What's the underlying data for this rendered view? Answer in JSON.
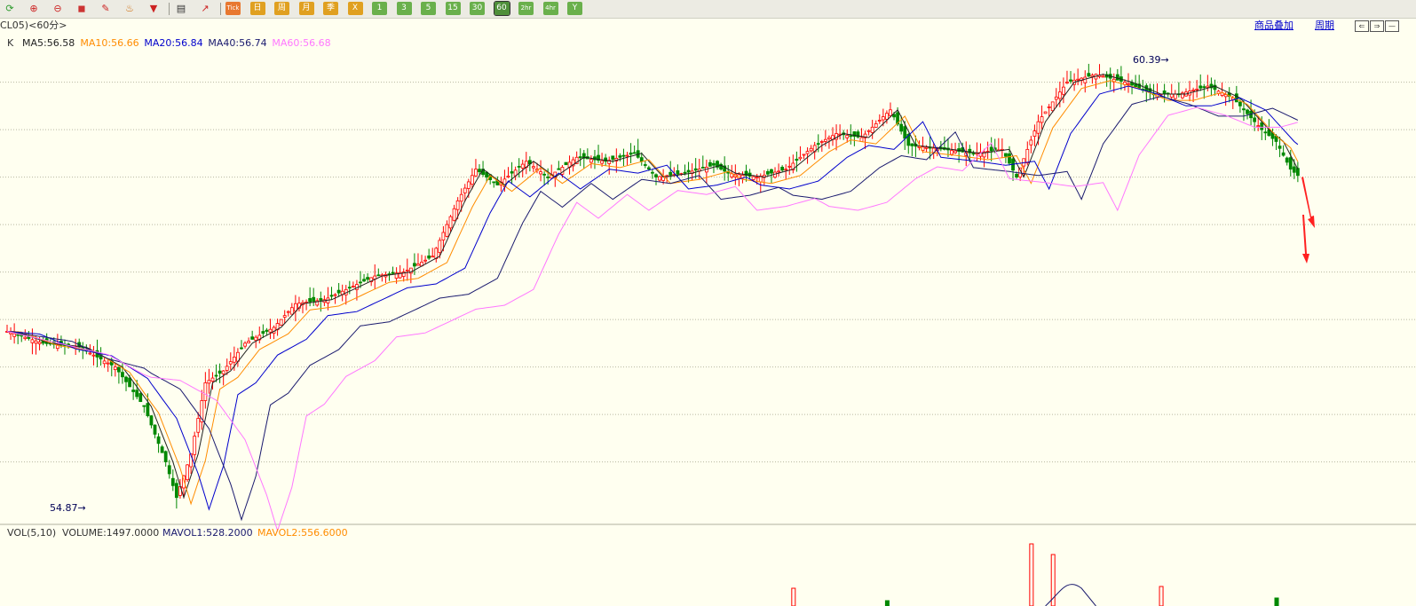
{
  "toolbar": {
    "buttons": [
      {
        "name": "refresh-icon",
        "label": "⟳",
        "kind": "ico",
        "color": "#2e9a2e"
      },
      {
        "name": "zoom-in-icon",
        "label": "⊕",
        "kind": "ico",
        "color": "#cc2222"
      },
      {
        "name": "zoom-out-icon",
        "label": "⊖",
        "kind": "ico",
        "color": "#cc2222"
      },
      {
        "name": "window-icon",
        "label": "◼",
        "kind": "ico",
        "color": "#cc3333"
      },
      {
        "name": "pencil-icon",
        "label": "✎",
        "kind": "ico",
        "color": "#cc2222"
      },
      {
        "name": "paint-icon",
        "label": "♨",
        "kind": "ico",
        "color": "#cc6600"
      },
      {
        "name": "filter-icon",
        "label": "▼",
        "kind": "ico",
        "color": "#cc2222"
      },
      {
        "name": "table-icon",
        "label": "▤",
        "kind": "ico",
        "color": "#333333"
      },
      {
        "name": "trend-icon",
        "label": "↗",
        "kind": "ico",
        "color": "#cc2222"
      },
      {
        "name": "tick-button",
        "label": "Tick",
        "kind": "sq",
        "color": "#e87830"
      },
      {
        "name": "day-button",
        "label": "日",
        "kind": "sq",
        "color": "#e0a020"
      },
      {
        "name": "week-button",
        "label": "周",
        "kind": "sq",
        "color": "#e0a020"
      },
      {
        "name": "month-button",
        "label": "月",
        "kind": "sq",
        "color": "#e0a020"
      },
      {
        "name": "season-button",
        "label": "季",
        "kind": "sq",
        "color": "#e0a020"
      },
      {
        "name": "x-button",
        "label": "X",
        "kind": "sq",
        "color": "#e0a020"
      },
      {
        "name": "1-button",
        "label": "1",
        "kind": "sq",
        "color": "#6ab04c"
      },
      {
        "name": "3-button",
        "label": "3",
        "kind": "sq",
        "color": "#6ab04c"
      },
      {
        "name": "5-button",
        "label": "5",
        "kind": "sq",
        "color": "#6ab04c"
      },
      {
        "name": "15-button",
        "label": "15",
        "kind": "sq",
        "color": "#6ab04c"
      },
      {
        "name": "30-button",
        "label": "30",
        "kind": "sq",
        "color": "#6ab04c"
      },
      {
        "name": "60-button",
        "label": "60",
        "kind": "sq",
        "color": "#6ab04c",
        "active": true
      },
      {
        "name": "2h-button",
        "label": "2hr",
        "kind": "sq",
        "color": "#6ab04c"
      },
      {
        "name": "4h-button",
        "label": "4hr",
        "kind": "sq",
        "color": "#6ab04c"
      },
      {
        "name": "y-button",
        "label": "Y",
        "kind": "sq",
        "color": "#6ab04c"
      }
    ]
  },
  "infobar": {
    "symbol": "CL05)<60分>",
    "overlay_link": "商品叠加",
    "period_link": "周期"
  },
  "chart_data": {
    "type": "candlestick",
    "title": "",
    "price_indicator_label": "K",
    "ma_labels": [
      {
        "text": "MA5:56.58",
        "color": "#222222"
      },
      {
        "text": "MA10:56.66",
        "color": "#ff8c00"
      },
      {
        "text": "MA20:56.84",
        "color": "#0000cc"
      },
      {
        "text": "MA40:56.74",
        "color": "#1a1a6e"
      },
      {
        "text": "MA60:56.68",
        "color": "#ff77ff"
      }
    ],
    "high_label": "60.39",
    "low_label": "54.87",
    "ylim": [
      54.7,
      60.7
    ],
    "y_ticks": [
      60.2,
      59.6,
      59.0,
      58.4,
      57.8,
      57.2,
      56.6,
      56.0,
      55.4
    ],
    "colors": {
      "up": "#ff0000",
      "down": "#008800",
      "ma5": "#222222",
      "ma10": "#ff8c00",
      "ma20": "#0000cc",
      "ma40": "#1a1a6e",
      "ma60": "#ff77ff",
      "grid": "#b8b8a0"
    },
    "path_points": [
      [
        0,
        57.05
      ],
      [
        10,
        56.9
      ],
      [
        20,
        56.85
      ],
      [
        30,
        56.6
      ],
      [
        38,
        56.1
      ],
      [
        44,
        55.4
      ],
      [
        47,
        54.95
      ],
      [
        51,
        55.5
      ],
      [
        55,
        56.4
      ],
      [
        60,
        56.55
      ],
      [
        66,
        56.9
      ],
      [
        74,
        57.1
      ],
      [
        80,
        57.4
      ],
      [
        88,
        57.45
      ],
      [
        95,
        57.6
      ],
      [
        102,
        57.75
      ],
      [
        110,
        57.8
      ],
      [
        118,
        58.0
      ],
      [
        125,
        58.7
      ],
      [
        130,
        59.1
      ],
      [
        136,
        58.9
      ],
      [
        144,
        59.2
      ],
      [
        150,
        59.0
      ],
      [
        158,
        59.25
      ],
      [
        166,
        59.2
      ],
      [
        174,
        59.3
      ],
      [
        180,
        59.0
      ],
      [
        188,
        59.05
      ],
      [
        196,
        59.15
      ],
      [
        200,
        59.05
      ],
      [
        208,
        59.0
      ],
      [
        216,
        59.1
      ],
      [
        224,
        59.4
      ],
      [
        230,
        59.55
      ],
      [
        237,
        59.5
      ],
      [
        245,
        59.85
      ],
      [
        250,
        59.4
      ],
      [
        260,
        59.35
      ],
      [
        268,
        59.3
      ],
      [
        276,
        59.35
      ],
      [
        280,
        59.0
      ],
      [
        286,
        59.7
      ],
      [
        294,
        60.2
      ],
      [
        302,
        60.3
      ],
      [
        310,
        60.2
      ],
      [
        318,
        60.05
      ],
      [
        325,
        60.05
      ],
      [
        333,
        60.15
      ],
      [
        340,
        60.0
      ],
      [
        348,
        59.6
      ],
      [
        352,
        59.45
      ],
      [
        356,
        59.1
      ],
      [
        358,
        59.02
      ]
    ],
    "ma_offsets": {
      "ma10": [
        4,
        -0.08
      ],
      "ma20": [
        9,
        -0.15
      ],
      "ma40": [
        18,
        -0.28
      ],
      "ma60": [
        28,
        -0.42
      ]
    },
    "down_bars_tail": 7,
    "volume": {
      "label": "VOL(5,10)",
      "volume_text": "VOLUME:1497.0000",
      "mavol1_text": "MAVOL1:528.2000",
      "mavol2_text": "MAVOL2:556.6000",
      "spikes": [
        [
          218,
          1,
          "up"
        ],
        [
          244,
          0.3,
          "down"
        ],
        [
          284,
          3.5,
          "up"
        ],
        [
          290,
          2.9,
          "up"
        ],
        [
          320,
          1.1,
          "up"
        ],
        [
          352,
          0.45,
          "down"
        ]
      ]
    }
  }
}
